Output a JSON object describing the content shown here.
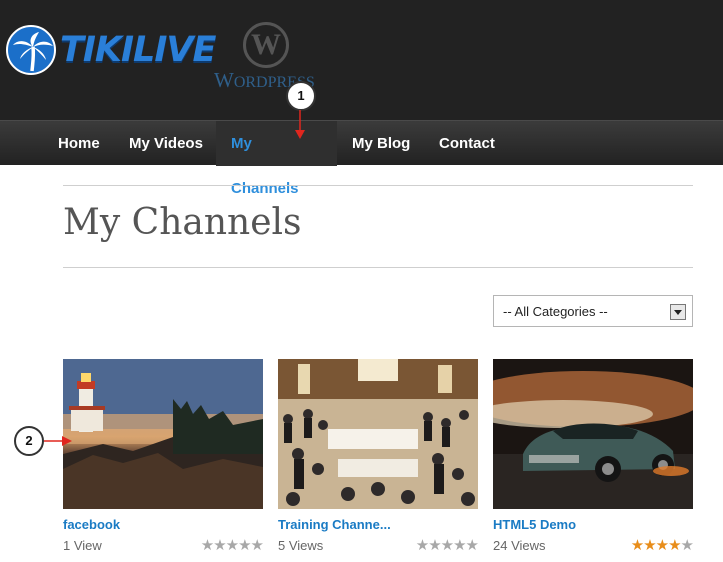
{
  "header": {
    "logo_text": "TIKILIVE",
    "wp_mark": "W",
    "wp_text_big": "W",
    "wp_text_rest": "ORDPRESS"
  },
  "nav": {
    "items": [
      {
        "label": "Home"
      },
      {
        "label": "My Videos"
      },
      {
        "label": "My Channels"
      },
      {
        "label": "My Blog"
      },
      {
        "label": "Contact"
      }
    ]
  },
  "callouts": [
    "1",
    "2"
  ],
  "page": {
    "title": "My Channels",
    "category_select": "-- All Categories --"
  },
  "channels": [
    {
      "title": "facebook",
      "views": "1 View",
      "rating": 0,
      "thumb": "lighthouse-at-sunset"
    },
    {
      "title": "Training Channe...",
      "views": "5 Views",
      "rating": 0,
      "thumb": "crowded-banquet-hall"
    },
    {
      "title": "HTML5 Demo",
      "views": "24 Views",
      "rating": 4,
      "thumb": "sports-car"
    }
  ],
  "colors": {
    "accent": "#1a7bc4",
    "nav_active": "#2f8fdc",
    "star_on": "#e88d1a",
    "star_off": "#a8a8a8",
    "callout_arrow": "#e0261e"
  }
}
